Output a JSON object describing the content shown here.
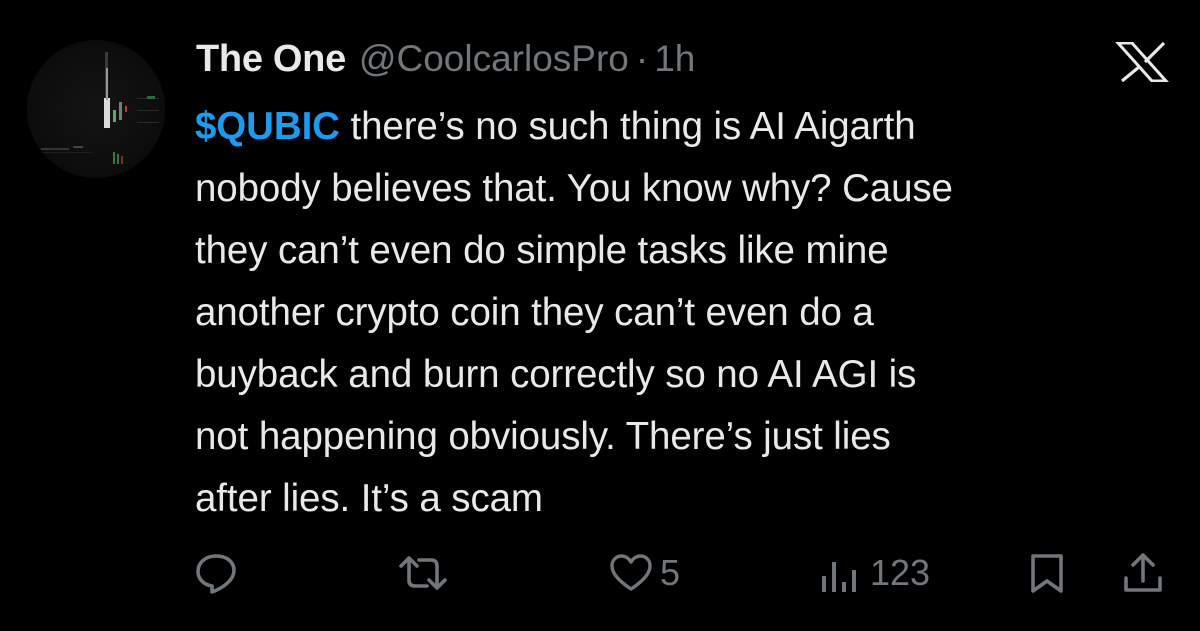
{
  "author": {
    "display_name": "The One",
    "handle": "@CoolcarlosPro",
    "separator": "·",
    "time": "1h"
  },
  "tweet": {
    "cashtag": "$QUBIC",
    "text": " there’s no such thing is AI Aigarth\nnobody believes that. You know why? Cause\nthey can’t even do simple tasks like mine\nanother crypto coin they can’t even do a\nbuyback and burn correctly so no AI AGI is\nnot happening obviously. There’s just lies\nafter lies. It’s a scam"
  },
  "actions": {
    "reply_icon": "reply-icon",
    "repost_icon": "repost-icon",
    "like_icon": "heart-icon",
    "like_count": "5",
    "views_icon": "views-icon",
    "views_count": "123",
    "bookmark_icon": "bookmark-icon",
    "share_icon": "share-icon"
  },
  "header_icons": {
    "platform_logo": "x-logo-icon"
  },
  "colors": {
    "background": "#000000",
    "text": "#e7e9ea",
    "muted": "#71767b",
    "accent": "#1d9bf0"
  }
}
